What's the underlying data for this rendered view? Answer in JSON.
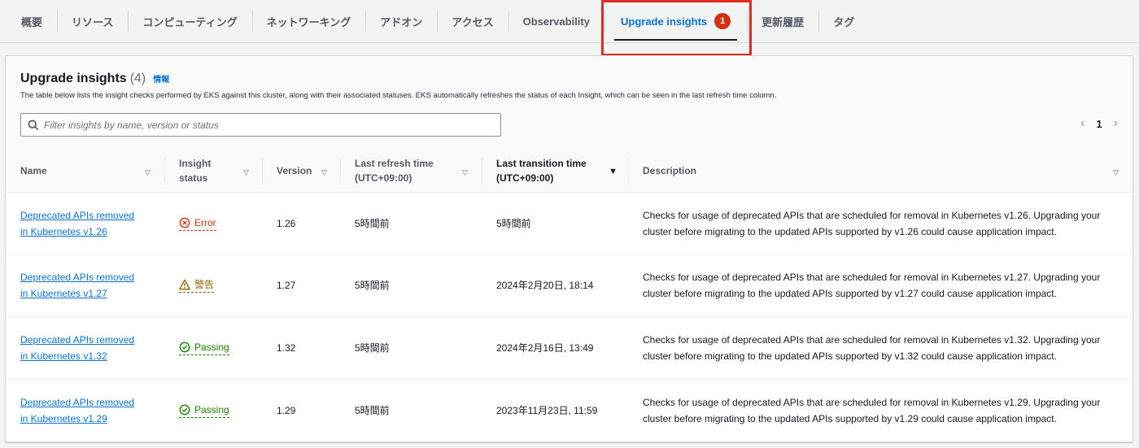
{
  "tabs": [
    {
      "label": "概要"
    },
    {
      "label": "リソース"
    },
    {
      "label": "コンピューティング"
    },
    {
      "label": "ネットワーキング"
    },
    {
      "label": "アドオン"
    },
    {
      "label": "アクセス"
    },
    {
      "label": "Observability"
    },
    {
      "label": "Upgrade insights",
      "badge": "1",
      "active": true
    },
    {
      "label": "更新履歴"
    },
    {
      "label": "タグ"
    }
  ],
  "panel": {
    "title": "Upgrade insights",
    "count": "(4)",
    "info": "情報",
    "description": "The table below lists the insight checks performed by EKS against this cluster, along with their associated statuses. EKS automatically refreshes the status of each Insight, which can be seen in the last refresh time column.",
    "search_placeholder": "Filter insights by name, version or status",
    "page": "1"
  },
  "columns": {
    "name": "Name",
    "status_line1": "Insight",
    "status_line2": "status",
    "version": "Version",
    "refresh_line1": "Last refresh time",
    "refresh_line2": "(UTC+09:00)",
    "transition_line1": "Last transition time",
    "transition_line2": "(UTC+09:00)",
    "description": "Description"
  },
  "rows": [
    {
      "name_line1": "Deprecated APIs removed",
      "name_line2": "in Kubernetes v1.26",
      "status": "Error",
      "status_kind": "error",
      "version": "1.26",
      "refresh": "5時間前",
      "transition": "5時間前",
      "description": "Checks for usage of deprecated APIs that are scheduled for removal in Kubernetes v1.26. Upgrading your cluster before migrating to the updated APIs supported by v1.26 could cause application impact."
    },
    {
      "name_line1": "Deprecated APIs removed",
      "name_line2": "in Kubernetes v1.27",
      "status": "警告",
      "status_kind": "warn",
      "version": "1.27",
      "refresh": "5時間前",
      "transition": "2024年2月20日, 18:14",
      "description": "Checks for usage of deprecated APIs that are scheduled for removal in Kubernetes v1.27. Upgrading your cluster before migrating to the updated APIs supported by v1.27 could cause application impact."
    },
    {
      "name_line1": "Deprecated APIs removed",
      "name_line2": "in Kubernetes v1.32",
      "status": "Passing",
      "status_kind": "pass",
      "version": "1.32",
      "refresh": "5時間前",
      "transition": "2024年2月16日, 13:49",
      "description": "Checks for usage of deprecated APIs that are scheduled for removal in Kubernetes v1.32. Upgrading your cluster before migrating to the updated APIs supported by v1.32 could cause application impact."
    },
    {
      "name_line1": "Deprecated APIs removed",
      "name_line2": "in Kubernetes v1.29",
      "status": "Passing",
      "status_kind": "pass",
      "version": "1.29",
      "refresh": "5時間前",
      "transition": "2023年11月23日, 11:59",
      "description": "Checks for usage of deprecated APIs that are scheduled for removal in Kubernetes v1.29. Upgrading your cluster before migrating to the updated APIs supported by v1.29 could cause application impact."
    }
  ]
}
